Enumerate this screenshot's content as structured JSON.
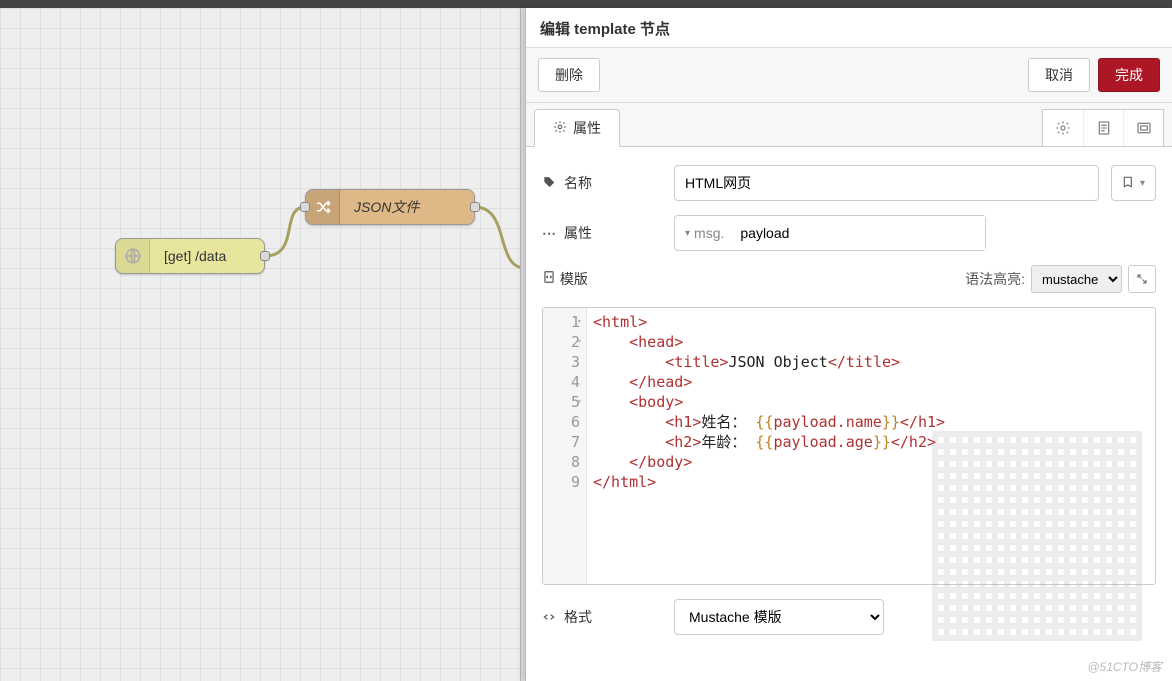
{
  "header": {
    "title": "编辑 template 节点"
  },
  "actions": {
    "delete": "删除",
    "cancel": "取消",
    "done": "完成"
  },
  "tabs": {
    "properties": "属性"
  },
  "form": {
    "name_label": "名称",
    "name_value": "HTML网页",
    "prop_label": "属性",
    "prop_prefix": "msg.",
    "prop_value": "payload",
    "template_label": "模版",
    "syntax_label": "语法高亮:",
    "syntax_value": "mustache",
    "format_label": "格式",
    "format_value": "Mustache 模版"
  },
  "editor": {
    "lines": [
      "1",
      "2",
      "3",
      "4",
      "5",
      "6",
      "7",
      "8",
      "9"
    ],
    "code_tokens": [
      [
        {
          "c": "t-tag",
          "t": "<html>"
        }
      ],
      [
        {
          "c": "",
          "t": "    "
        },
        {
          "c": "t-tag",
          "t": "<head>"
        }
      ],
      [
        {
          "c": "",
          "t": "        "
        },
        {
          "c": "t-tag",
          "t": "<title>"
        },
        {
          "c": "t-text",
          "t": "JSON Object"
        },
        {
          "c": "t-tag",
          "t": "</title>"
        }
      ],
      [
        {
          "c": "",
          "t": "    "
        },
        {
          "c": "t-tag",
          "t": "</head>"
        }
      ],
      [
        {
          "c": "",
          "t": "    "
        },
        {
          "c": "t-tag",
          "t": "<body>"
        }
      ],
      [
        {
          "c": "",
          "t": "        "
        },
        {
          "c": "t-tag",
          "t": "<h1>"
        },
        {
          "c": "t-text",
          "t": "姓名： "
        },
        {
          "c": "t-var",
          "t": "{{"
        },
        {
          "c": "t-prop",
          "t": "payload.name"
        },
        {
          "c": "t-var",
          "t": "}}"
        },
        {
          "c": "t-tag",
          "t": "</h1>"
        }
      ],
      [
        {
          "c": "",
          "t": "        "
        },
        {
          "c": "t-tag",
          "t": "<h2>"
        },
        {
          "c": "t-text",
          "t": "年龄： "
        },
        {
          "c": "t-var",
          "t": "{{"
        },
        {
          "c": "t-prop",
          "t": "payload.age"
        },
        {
          "c": "t-var",
          "t": "}}"
        },
        {
          "c": "t-tag",
          "t": "</h2>"
        }
      ],
      [
        {
          "c": "",
          "t": "    "
        },
        {
          "c": "t-tag",
          "t": "</body>"
        }
      ],
      [
        {
          "c": "t-tag",
          "t": "</html>"
        }
      ]
    ]
  },
  "flow": {
    "nodes": {
      "http": "[get] /data",
      "json": "JSON文件"
    }
  },
  "watermark": "@51CTO博客"
}
